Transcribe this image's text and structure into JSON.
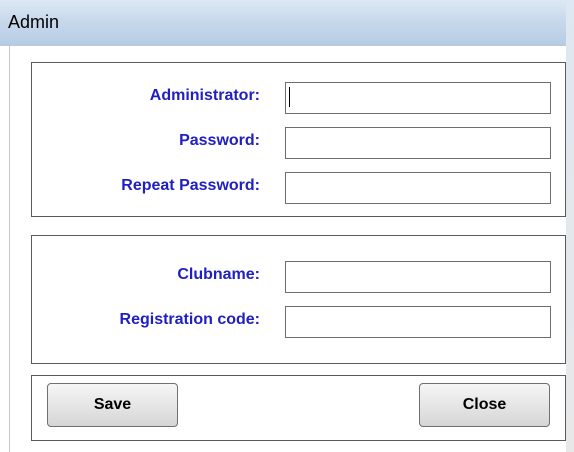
{
  "window": {
    "title": "Admin"
  },
  "account": {
    "administrator_label": "Administrator:",
    "administrator_value": "",
    "password_label": "Password:",
    "password_value": "",
    "repeat_password_label": "Repeat Password:",
    "repeat_password_value": ""
  },
  "club": {
    "clubname_label": "Clubname:",
    "clubname_value": "",
    "registration_code_label": "Registration code:",
    "registration_code_value": ""
  },
  "actions": {
    "save_label": "Save",
    "close_label": "Close"
  },
  "colors": {
    "label_text": "#2020c0",
    "titlebar": "#c8d9ec",
    "group_border": "#5a5a5a"
  }
}
